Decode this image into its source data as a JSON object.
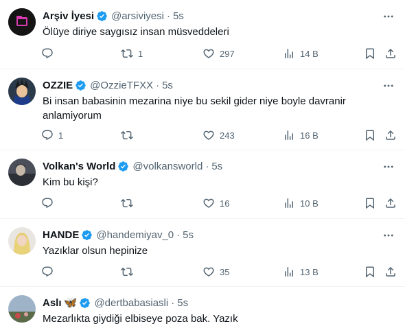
{
  "tweets": [
    {
      "name": "Arşiv İyesi",
      "handle": "@arsiviyesi",
      "time": "5s",
      "text": "Ölüye diriye saygısız insan müsveddeleri",
      "reply_count": "",
      "retweet_count": "1",
      "like_count": "297",
      "views": "14 B"
    },
    {
      "name": "OZZIE",
      "handle": "@OzzieTFXX",
      "time": "5s",
      "text": "Bi insan babasinin mezarina niye bu sekil gider niye boyle davranir anlamiyorum",
      "reply_count": "1",
      "retweet_count": "",
      "like_count": "243",
      "views": "16 B"
    },
    {
      "name": "Volkan's World",
      "handle": "@volkansworld",
      "time": "5s",
      "text": "Kim bu kişi?",
      "reply_count": "",
      "retweet_count": "",
      "like_count": "16",
      "views": "10 B"
    },
    {
      "name": "HANDE",
      "handle": "@handemiyav_0",
      "time": "5s",
      "text": "Yazıklar olsun hepinize",
      "reply_count": "",
      "retweet_count": "",
      "like_count": "35",
      "views": "13 B"
    },
    {
      "name": "Aslı",
      "name_emoji": "🦋",
      "handle": "@dertbabasiasli",
      "time": "5s",
      "text": "Mezarlıkta giydiği elbiseye poza bak. Yazık"
    }
  ],
  "separator": "·",
  "icons": {
    "reply": "reply-icon",
    "retweet": "retweet-icon",
    "like": "like-icon",
    "views": "views-icon",
    "bookmark": "bookmark-icon",
    "share": "share-icon",
    "more": "more-icon",
    "verified": "verified-badge-icon"
  },
  "colors": {
    "verified": "#1d9bf0",
    "secondary_text": "#536471",
    "primary_text": "#0f1419",
    "divider": "#eff3f4"
  }
}
